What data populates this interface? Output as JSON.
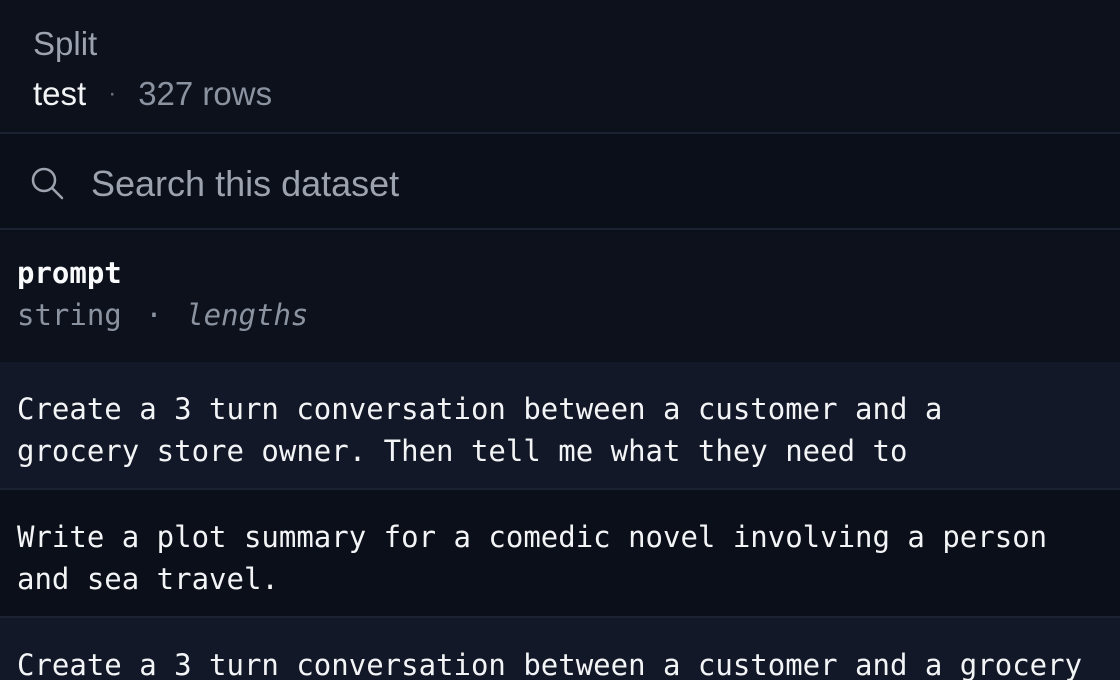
{
  "split": {
    "label": "Split",
    "value": "test",
    "separator": "·",
    "row_count": "327 rows"
  },
  "search": {
    "icon": "search-icon",
    "placeholder": "Search this dataset",
    "value": ""
  },
  "column": {
    "name": "prompt",
    "type": "string",
    "separator": "·",
    "stats": "lengths"
  },
  "rows": [
    {
      "prompt": "Create a 3 turn conversation between a customer and a\ngrocery store owner. Then tell me what they need to"
    },
    {
      "prompt": "Write a plot summary for a comedic novel involving a person\nand sea travel."
    },
    {
      "prompt": "Create a 3 turn conversation between a customer and a grocery"
    }
  ],
  "colors": {
    "background": "#0b0f19",
    "row_alt": "#121827",
    "divider": "#1b2232",
    "muted_text": "#8b93a1"
  }
}
